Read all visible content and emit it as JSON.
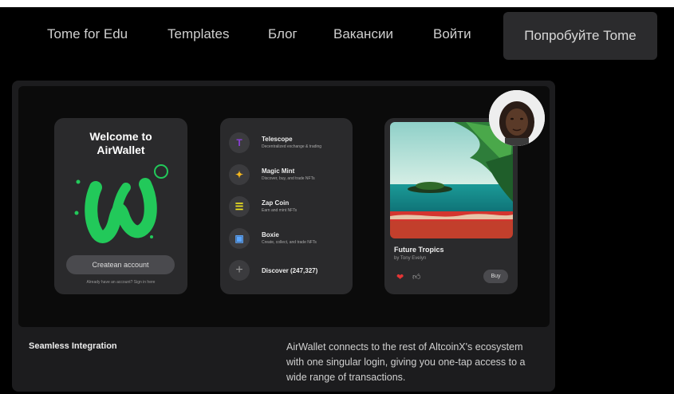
{
  "nav": {
    "links": [
      "Tome for Edu",
      "Templates",
      "Блог",
      "Вакансии",
      "Войти"
    ],
    "cta": "Попробуйте Tome"
  },
  "wallet": {
    "welcome_line1": "Welcome to",
    "welcome_line2": "AirWallet",
    "create_button": "Createan account",
    "already": "Already have an account? Sign in here"
  },
  "apps": {
    "items": [
      {
        "name": "Telescope",
        "desc": "Decentralized exchange & trading",
        "icon": "T",
        "color": "#8b3fd9"
      },
      {
        "name": "Magic Mint",
        "desc": "Discover, buy, and trade NFTs",
        "icon": "✦",
        "color": "#f3b61f"
      },
      {
        "name": "Zap Coin",
        "desc": "Earn and mint NFTs",
        "icon": "☰",
        "color": "#f3e61f"
      },
      {
        "name": "Boxie",
        "desc": "Create, collect, and trade NFTs",
        "icon": "▣",
        "color": "#5aa6ff"
      }
    ],
    "discover": "Discover (247,327)"
  },
  "nft": {
    "title": "Future Tropics",
    "by": "by Tony Evelyn",
    "buy": "Buy"
  },
  "feature": {
    "title": "Seamless Integration",
    "body": "AirWallet connects to the rest of AltcoinX's ecosystem with one singular login, giving you one-tap access to a wide range of transactions."
  }
}
